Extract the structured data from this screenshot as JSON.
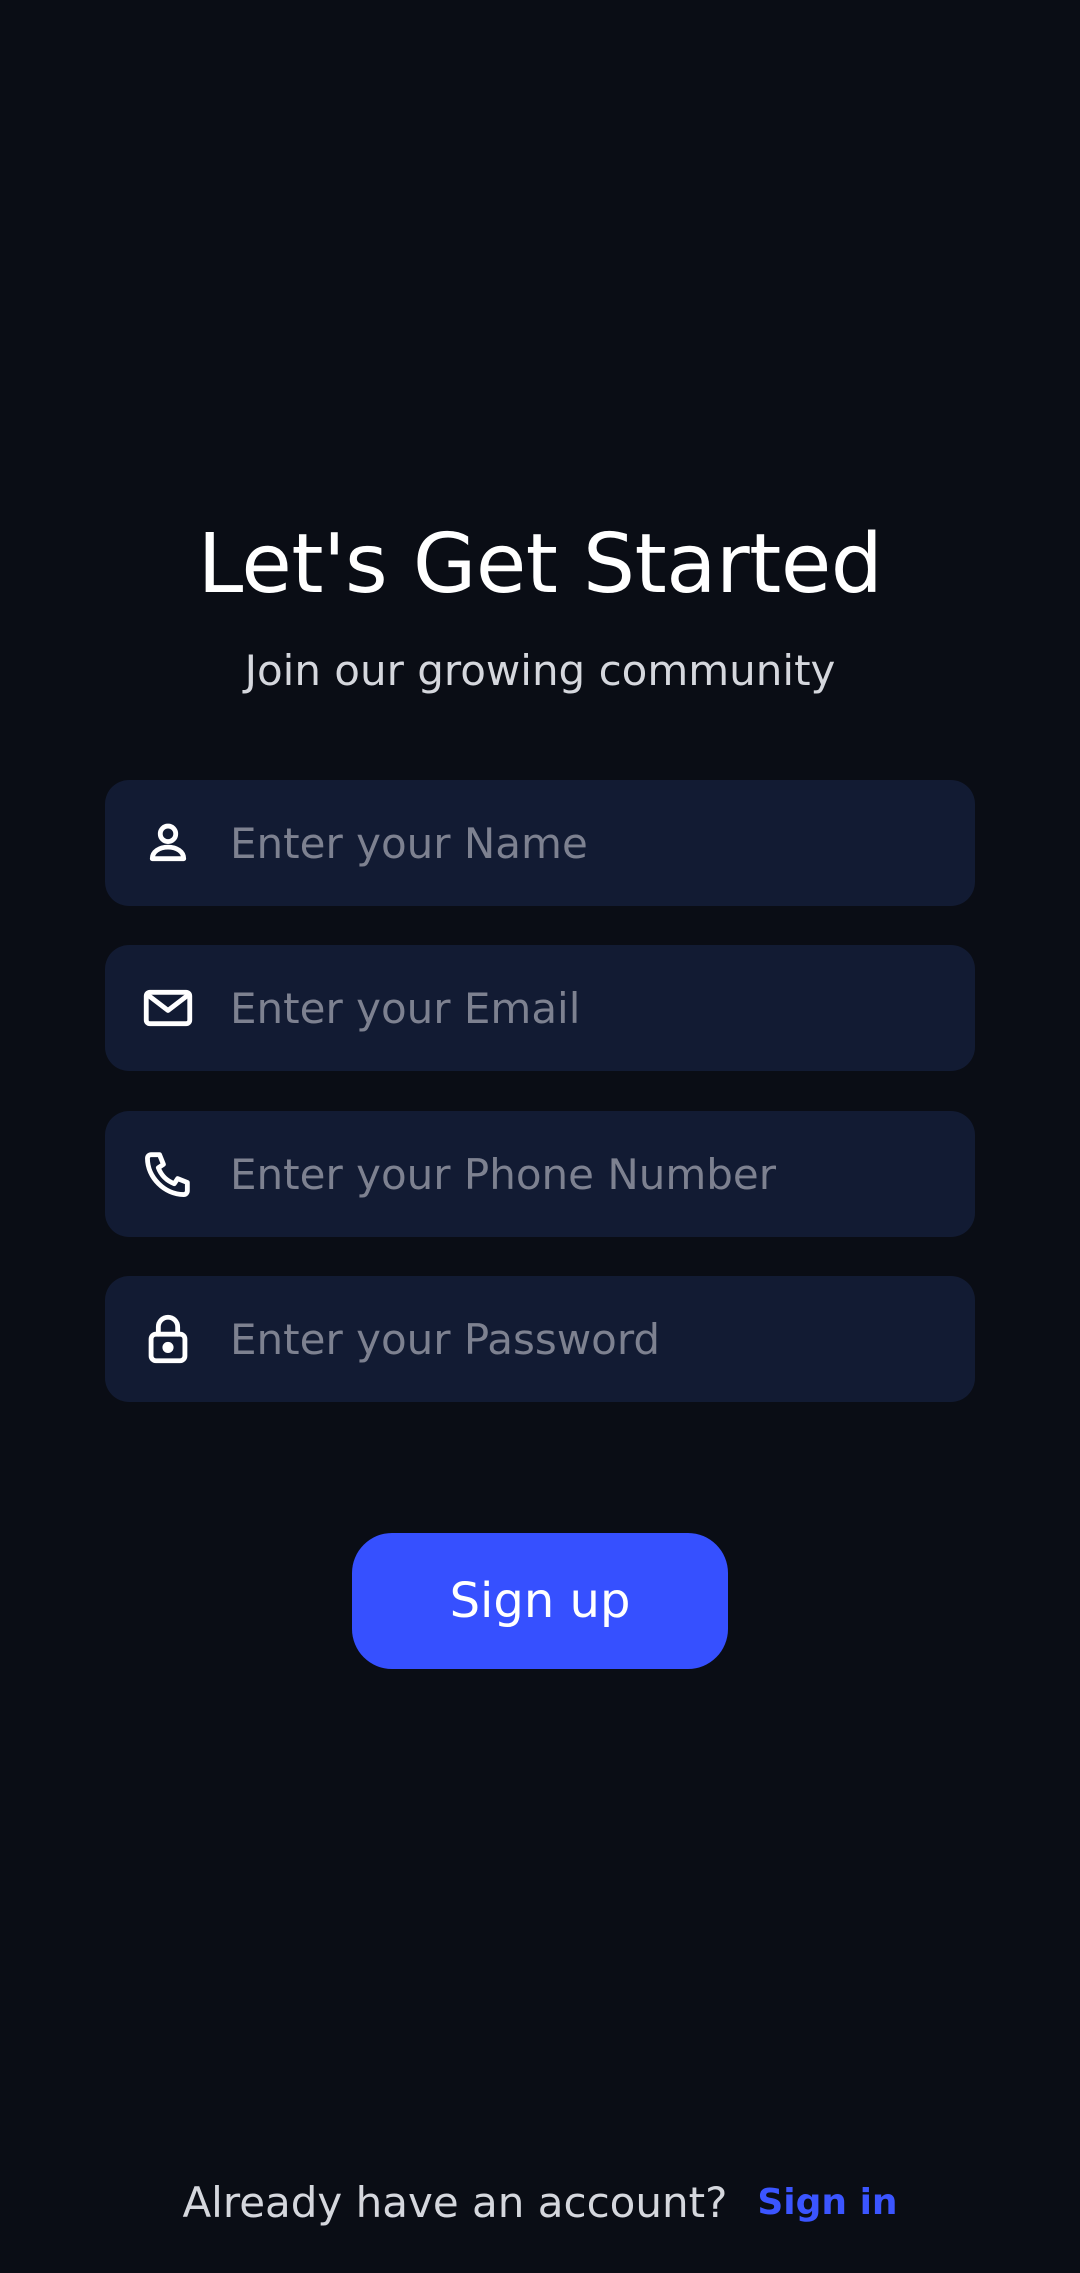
{
  "header": {
    "title": "Let's Get Started",
    "subtitle": "Join our growing community"
  },
  "form": {
    "fields": [
      {
        "icon": "person-icon",
        "value": "",
        "placeholder": "Enter your Name"
      },
      {
        "icon": "mail-icon",
        "value": "",
        "placeholder": "Enter your Email"
      },
      {
        "icon": "phone-icon",
        "value": "",
        "placeholder": "Enter your Phone Number"
      },
      {
        "icon": "lock-icon",
        "value": "",
        "placeholder": "Enter your Password"
      }
    ],
    "submit_label": "Sign up"
  },
  "footer": {
    "prompt": "Already have an account?",
    "link_label": "Sign in"
  },
  "colors": {
    "background": "#0a0d15",
    "field_background": "#121b33",
    "accent": "#3650ff",
    "link": "#3b55ff",
    "placeholder": "#7d8190"
  }
}
